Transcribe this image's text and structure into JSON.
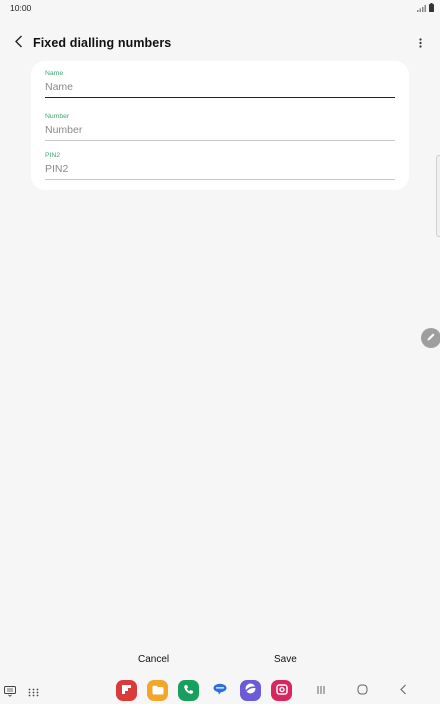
{
  "status_bar": {
    "time": "10:00"
  },
  "app_bar": {
    "title": "Fixed dialling numbers"
  },
  "form": {
    "fields": [
      {
        "label": "Name",
        "value": "",
        "placeholder": "Name"
      },
      {
        "label": "Number",
        "value": "",
        "placeholder": "Number"
      },
      {
        "label": "PIN2",
        "value": "",
        "placeholder": "PIN2"
      }
    ]
  },
  "actions": {
    "cancel_label": "Cancel",
    "save_label": "Save"
  },
  "dock": {
    "apps": [
      {
        "icon": "flipboard-icon",
        "color": "#d93a3a"
      },
      {
        "icon": "my-files-icon",
        "color": "#f2a62a"
      },
      {
        "icon": "phone-icon",
        "color": "#1a9e5e"
      },
      {
        "icon": "messages-icon",
        "color": "#2e6fe0"
      },
      {
        "icon": "internet-icon",
        "color": "#6b5bd6"
      },
      {
        "icon": "camera-icon",
        "color": "#d9265e"
      }
    ]
  },
  "colors": {
    "accent": "#3aa86a",
    "card": "#ffffff",
    "background": "#f6f6f6"
  }
}
